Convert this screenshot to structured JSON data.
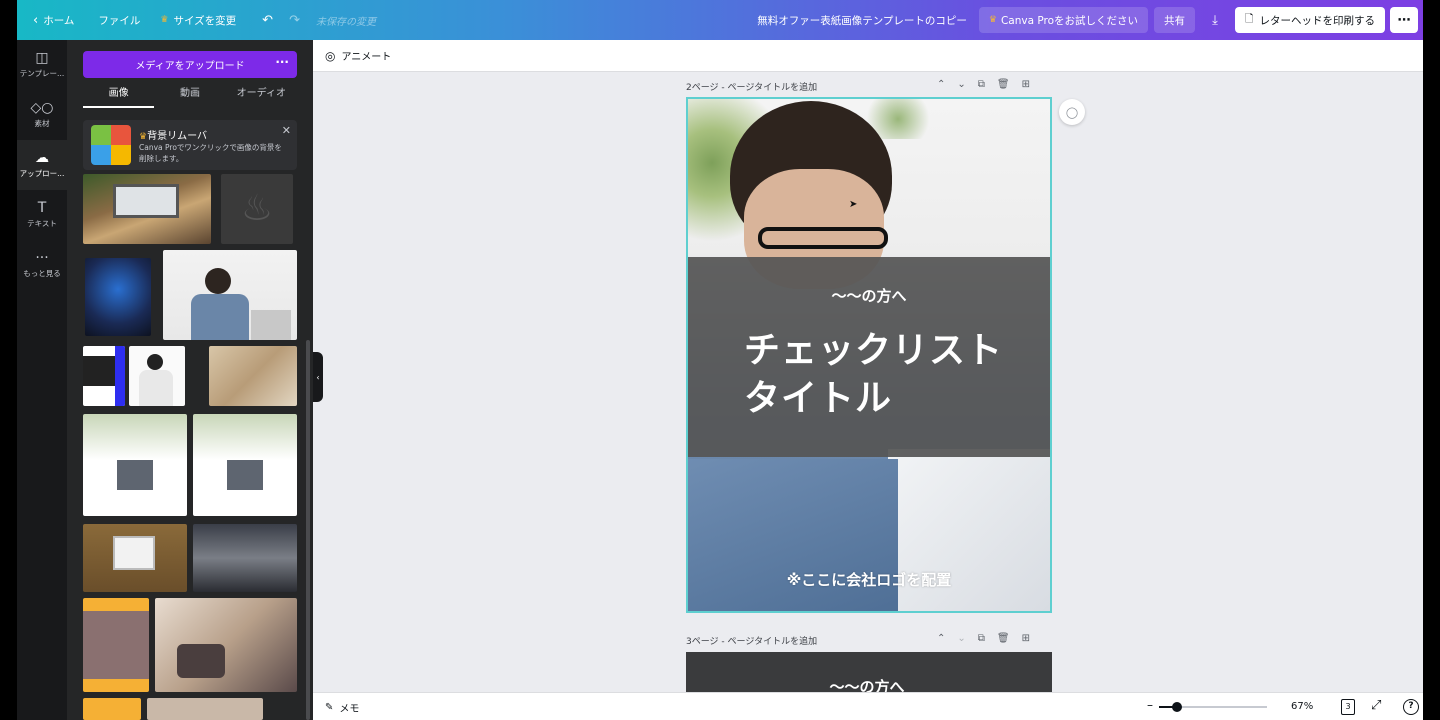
{
  "topbar": {
    "home": "ホーム",
    "file": "ファイル",
    "resize": "サイズを変更",
    "unsaved": "未保存の変更",
    "doc_title": "無料オファー表紙画像テンプレートのコピー",
    "try_pro": "Canva Proをお試しください",
    "share": "共有",
    "print": "レターヘッドを印刷する"
  },
  "rail": [
    {
      "icon": "template-icon",
      "label": "テンプレー..."
    },
    {
      "icon": "elements-icon",
      "label": "素材"
    },
    {
      "icon": "upload-icon",
      "label": "アップロー..."
    },
    {
      "icon": "text-icon",
      "label": "テキスト"
    },
    {
      "icon": "more-icon",
      "label": "もっと見る"
    }
  ],
  "panel": {
    "upload_button": "メディアをアップロード",
    "tabs": [
      "画像",
      "動画",
      "オーディオ"
    ],
    "promo_title": "背景リムーバ",
    "promo_desc": "Canva Proでワンクリックで画像の背景を削除します。"
  },
  "editor": {
    "animate": "アニメート",
    "page2_title": "2ページ - ページタイトルを追加",
    "page3_title": "3ページ - ページタイトルを追加",
    "audience": "〜〜の方へ",
    "title_line1": "チェックリスト",
    "title_line2": "タイトル",
    "logo_note": "※ここに会社ロゴを配置",
    "page3_audience": "〜〜の方へ"
  },
  "footer": {
    "memo": "メモ",
    "zoom": "67%",
    "zoom_level_percent": 67,
    "page_count": "3"
  },
  "colors": {
    "accent": "#7d2ae8",
    "selection": "#5ecfd0",
    "panel_bg": "#252627",
    "rail_bg": "#18191b"
  }
}
